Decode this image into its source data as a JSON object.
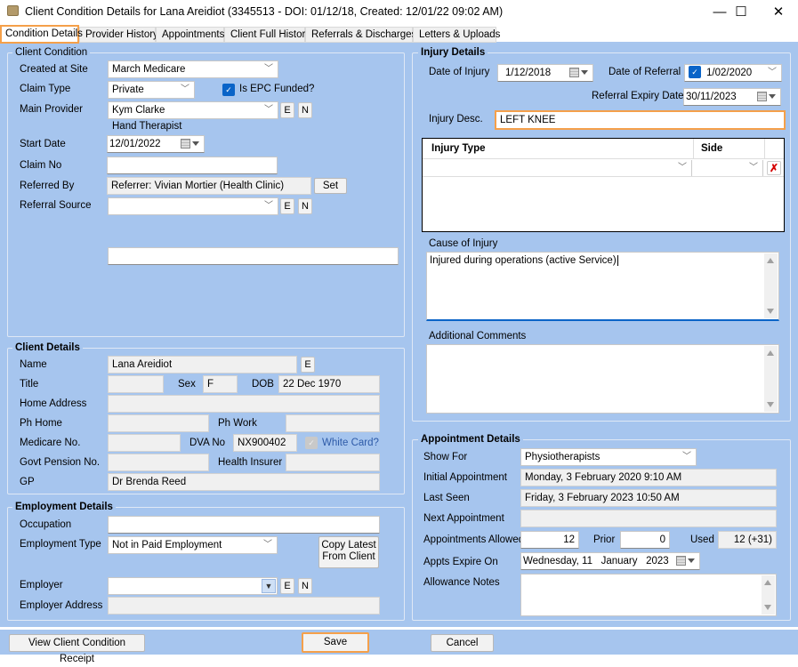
{
  "window": {
    "title": "Client Condition Details for Lana Areidiot  (3345513 - DOI: 01/12/18, Created: 12/01/22 09:02 AM)",
    "icon": "folder-icon",
    "minimize": "—",
    "maximize": "☐",
    "close": "✕"
  },
  "tabs": [
    {
      "label": "Condition Details",
      "active": true
    },
    {
      "label": "Provider History"
    },
    {
      "label": "Appointments"
    },
    {
      "label": "Client Full History"
    },
    {
      "label": "Referrals & Discharges"
    },
    {
      "label": "Letters & Uploads"
    }
  ],
  "client_condition": {
    "title": "Client Condition",
    "created_at_site_label": "Created at Site",
    "created_at_site": "March Medicare",
    "claim_type_label": "Claim Type",
    "claim_type": "Private",
    "epc_label": "Is EPC Funded?",
    "epc_checked": true,
    "main_provider_label": "Main Provider",
    "main_provider": "Kym Clarke",
    "main_provider_role": "Hand Therapist",
    "start_date_label": "Start Date",
    "start_date": "12/01/2022",
    "claim_no_label": "Claim No",
    "claim_no": "",
    "referred_by_label": "Referred By",
    "referred_by": "Referrer: Vivian Mortier (Health Clinic)",
    "set_label": "Set",
    "referral_source_label": "Referral Source",
    "referral_source": "",
    "extra_field": "",
    "e_label": "E",
    "n_label": "N"
  },
  "client_details": {
    "title": "Client Details",
    "name_label": "Name",
    "name": "Lana Areidiot",
    "title_label": "Title",
    "title_value": "",
    "sex_label": "Sex",
    "sex": "F",
    "dob_label": "DOB",
    "dob": "22 Dec 1970",
    "home_address_label": "Home Address",
    "home_address": "",
    "ph_home_label": "Ph Home",
    "ph_home": "",
    "ph_work_label": "Ph Work",
    "ph_work": "",
    "medicare_label": "Medicare No.",
    "medicare": "",
    "dva_label": "DVA No",
    "dva": "NX900402",
    "white_card_label": "White Card?",
    "white_card_checked": true,
    "govt_pension_label": "Govt Pension No.",
    "govt_pension": "",
    "health_insurer_label": "Health Insurer",
    "health_insurer": "",
    "gp_label": "GP",
    "gp": "Dr Brenda Reed"
  },
  "employment": {
    "title": "Employment Details",
    "occupation_label": "Occupation",
    "occupation": "",
    "employment_type_label": "Employment Type",
    "employment_type": "Not in Paid Employment",
    "copy_latest_line1": "Copy Latest",
    "copy_latest_line2": "From Client",
    "employer_label": "Employer",
    "employer": "",
    "employer_address_label": "Employer Address",
    "employer_address": ""
  },
  "injury": {
    "title": "Injury Details",
    "date_of_injury_label": "Date of Injury",
    "date_of_injury": "1/12/2018",
    "date_of_referral_label": "Date of Referral",
    "date_of_referral": "1/02/2020",
    "date_of_referral_checked": true,
    "referral_expiry_label": "Referral Expiry Date",
    "referral_expiry": "30/11/2023",
    "desc_label": "Injury Desc.",
    "desc": "LEFT KNEE",
    "grid_headers": [
      "Injury Type",
      "Side"
    ],
    "grid_rows": [
      {
        "injury_type": "",
        "side": ""
      }
    ],
    "cause_label": "Cause of Injury",
    "cause": "Injured during operations (active Service)",
    "comments_label": "Additional Comments",
    "comments": ""
  },
  "appointment": {
    "title": "Appointment Details",
    "show_for_label": "Show For",
    "show_for": "Physiotherapists",
    "initial_label": "Initial Appointment",
    "initial": "Monday, 3 February 2020 9:10 AM",
    "last_seen_label": "Last Seen",
    "last_seen": "Friday, 3 February 2023 10:50 AM",
    "next_label": "Next Appointment",
    "next": "",
    "allowed_label": "Appointments Allowed",
    "allowed": "12",
    "prior_label": "Prior",
    "prior": "0",
    "used_label": "Used",
    "used": "12 (+31)",
    "expire_label": "Appts Expire On",
    "expire": "Wednesday, 11   January   2023",
    "notes_label": "Allowance Notes",
    "notes": ""
  },
  "footer": {
    "receipt_label": "View Client Condition Receipt",
    "save_label": "Save",
    "cancel_label": "Cancel"
  }
}
